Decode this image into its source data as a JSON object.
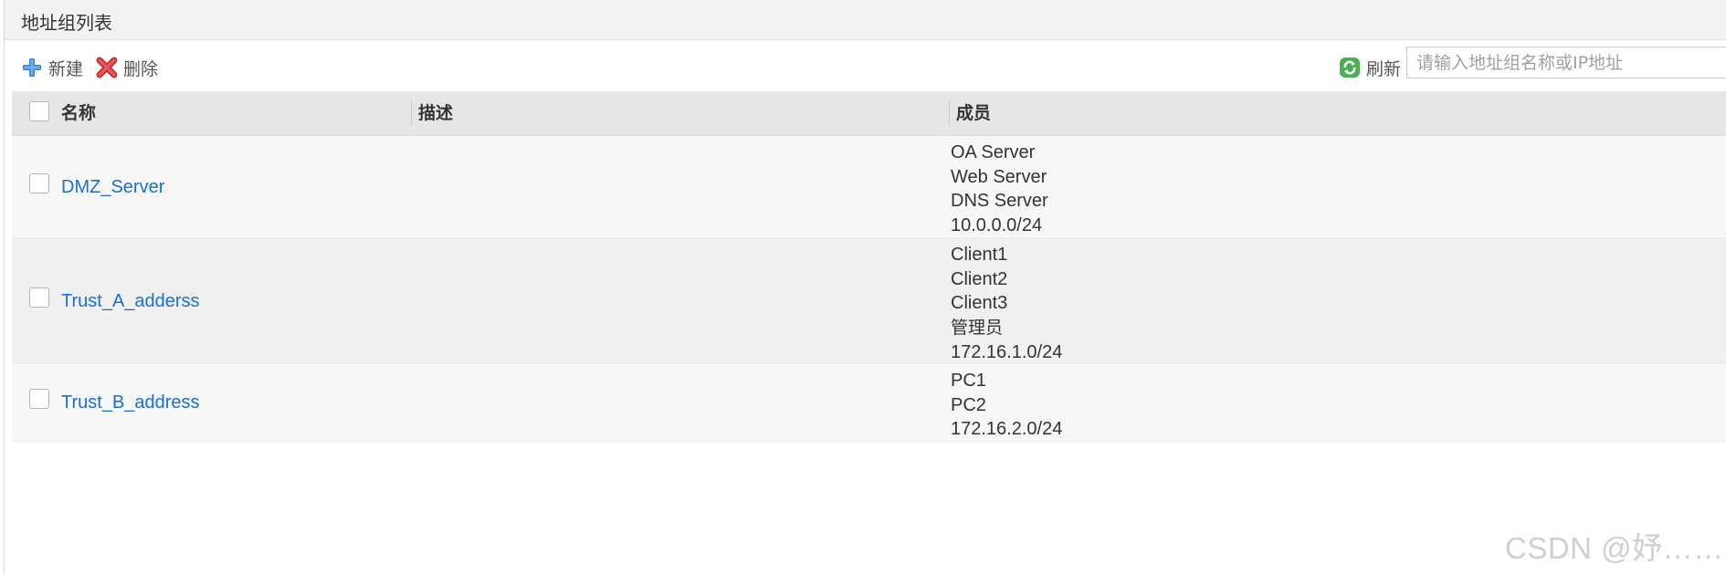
{
  "page": {
    "title": "地址组列表"
  },
  "toolbar": {
    "new_label": "新建",
    "delete_label": "删除",
    "refresh_label": "刷新",
    "search": {
      "placeholder": "请输入地址组名称或IP地址",
      "value": ""
    }
  },
  "table": {
    "columns": [
      "名称",
      "描述",
      "成员"
    ],
    "rows": [
      {
        "name": "DMZ_Server",
        "description": "",
        "members": [
          "OA Server",
          "Web Server",
          "DNS Server",
          "10.0.0.0/24"
        ]
      },
      {
        "name": "Trust_A_adderss",
        "description": "",
        "members": [
          "Client1",
          "Client2",
          "Client3",
          "管理员",
          "172.16.1.0/24"
        ]
      },
      {
        "name": "Trust_B_address",
        "description": "",
        "members": [
          "PC1",
          "PC2",
          "172.16.2.0/24"
        ]
      }
    ]
  },
  "watermark": "CSDN @妤……",
  "icons": {
    "new": "plus-icon",
    "delete": "delete-x-icon",
    "refresh": "refresh-icon"
  },
  "colors": {
    "link": "#1a6fd0",
    "header_bg": "#e6e6e6",
    "row_alt_bg": "#f5f5f5",
    "delete_red": "#e03c3c",
    "new_blue": "#3a86d6",
    "refresh_green": "#4caf50"
  }
}
